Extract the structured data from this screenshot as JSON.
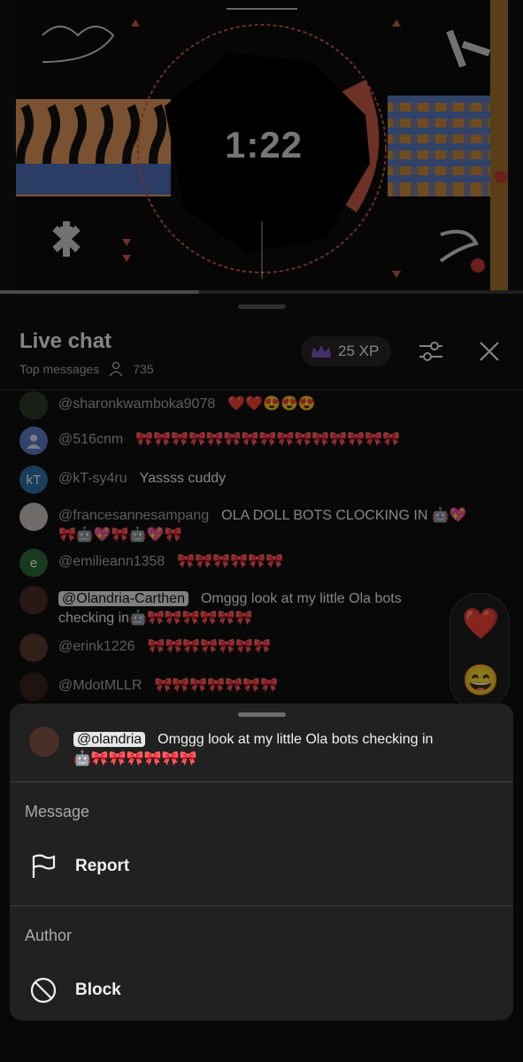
{
  "video": {
    "countdown": "1:22",
    "progress": 0.38
  },
  "chat": {
    "title": "Live chat",
    "mode": "Top messages",
    "viewers": "735",
    "xp": "25 XP",
    "messages": [
      {
        "author": "@sharonkwamboka9078",
        "text": "❤️❤️😍😍😍",
        "avatar": "pattern"
      },
      {
        "author": "@516cnm",
        "text": "🎀🎀🎀🎀🎀🎀🎀🎀🎀🎀🎀🎀🎀🎀🎀",
        "avatar": "default"
      },
      {
        "author": "@kT-sy4ru",
        "text": "Yassss cuddy",
        "avatar": "kT"
      },
      {
        "author": "@francesannesampang",
        "text": "OLA DOLL BOTS CLOCKING IN 🤖💖",
        "text2": "🎀🤖💖🎀🤖💖🎀",
        "avatar": "photo"
      },
      {
        "author": "@emilieann1358",
        "text": "🎀🎀🎀🎀🎀🎀",
        "avatar": "e"
      },
      {
        "author": "@Olandria-Carthen",
        "text": "Omggg look at my little Ola bots",
        "text2": "checking in🤖🎀🎀🎀🎀🎀🎀",
        "avatar": "photo"
      },
      {
        "author": "@erink1226",
        "text": "🎀🎀🎀🎀🎀🎀🎀",
        "avatar": "photo"
      },
      {
        "author": "@MdotMLLR",
        "text": "🎀🎀🎀🎀🎀🎀🎀",
        "avatar": "photo"
      }
    ],
    "reactions": [
      "❤️",
      "😄"
    ]
  },
  "sheet": {
    "author": "@olandria",
    "text": "Omggg look at my little Ola bots checking in",
    "text2": "🤖🎀🎀🎀🎀🎀🎀",
    "message_section": "Message",
    "report_label": "Report",
    "author_section": "Author",
    "block_label": "Block"
  },
  "colors": {
    "background": "#0f0f0f",
    "sheet": "#212121",
    "accent": "#f1f1f1",
    "muted": "#aaaaaa"
  }
}
